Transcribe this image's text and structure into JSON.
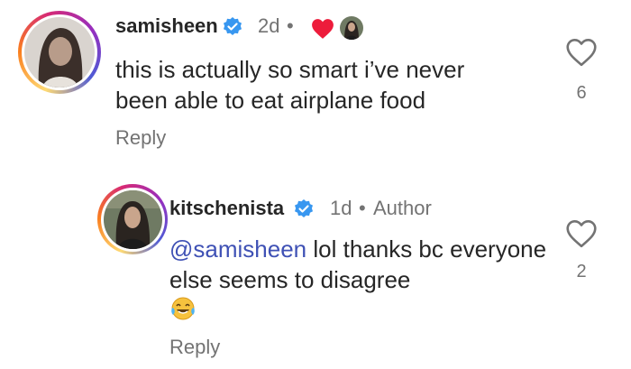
{
  "comments": [
    {
      "username": "samisheen",
      "time": "2d",
      "separator": "•",
      "text": "this is actually so smart i’ve never been able to eat airplane food",
      "reply_label": "Reply",
      "like_count": "6",
      "liked_by_author": true
    },
    {
      "username": "kitschenista",
      "time": "1d",
      "separator": "•",
      "author_label": "Author",
      "mention": "@samisheen",
      "text": " lol thanks bc everyone else seems to disagree",
      "emoji": "😂",
      "reply_label": "Reply",
      "like_count": "2"
    }
  ],
  "icons": {
    "verified": "verified-badge-icon",
    "like": "heart-outline-icon",
    "author_liked": "heart-filled-icon"
  },
  "colors": {
    "verified": "#3897f0",
    "liked_heart": "#ed1c3b",
    "mention": "#3f51b5",
    "muted": "#737373"
  }
}
